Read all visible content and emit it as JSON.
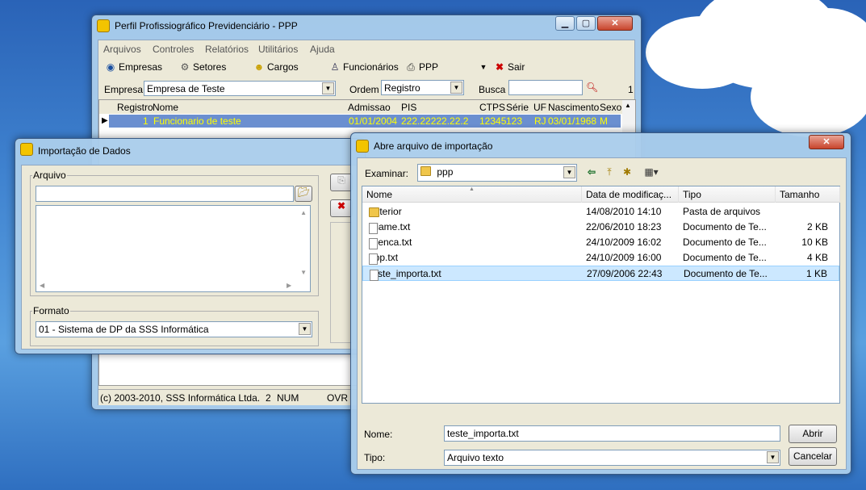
{
  "main_window": {
    "title": "Perfil Profissiográfico Previdenciário - PPP",
    "menu": [
      "Arquivos",
      "Controles",
      "Relatórios",
      "Utilitários",
      "Ajuda"
    ],
    "toolbar": {
      "empresas": "Empresas",
      "setores": "Setores",
      "cargos": "Cargos",
      "funcionarios": "Funcionários",
      "ppp": "PPP",
      "sair": "Sair"
    },
    "filter": {
      "empresa_label": "Empresa",
      "empresa_value": "Empresa de Teste",
      "ordem_label": "Ordem",
      "ordem_value": "Registro",
      "busca_label": "Busca",
      "busca_value": "",
      "count": "1"
    },
    "grid": {
      "headers": [
        "Registro",
        "Nome",
        "Admissao",
        "PIS",
        "CTPS",
        "Série",
        "UF",
        "Nascimento",
        "Sexo"
      ],
      "rows": [
        [
          "1",
          "Funcionario de teste",
          "01/01/2004",
          "222.22222.22.2",
          "12345",
          "123",
          "RJ",
          "03/01/1968",
          "M"
        ]
      ]
    },
    "status": {
      "copyright": "(c) 2003-2010, SSS Informática Ltda.",
      "panel2": "2",
      "num": "NUM",
      "ovr": "OVR"
    }
  },
  "import_window": {
    "title": "Importação de Dados",
    "arquivo_label": "Arquivo",
    "arquivo_value": "",
    "formato_label": "Formato",
    "formato_value": "01 - Sistema de DP da SSS Informática"
  },
  "file_dialog": {
    "title": "Abre arquivo de importação",
    "lookin_label": "Examinar:",
    "lookin_value": "ppp",
    "columns": [
      "Nome",
      "Data de modificaç...",
      "Tipo",
      "Tamanho"
    ],
    "files": [
      {
        "name": "anterior",
        "date": "14/08/2010 14:10",
        "type": "Pasta de arquivos",
        "size": "",
        "icon": "folder-icon"
      },
      {
        "name": "leiame.txt",
        "date": "22/06/2010 18:23",
        "type": "Documento de Te...",
        "size": "2 KB",
        "icon": "text-file-icon"
      },
      {
        "name": "licenca.txt",
        "date": "24/10/2009 16:02",
        "type": "Documento de Te...",
        "size": "10 KB",
        "icon": "text-file-icon"
      },
      {
        "name": "ppp.txt",
        "date": "24/10/2009 16:00",
        "type": "Documento de Te...",
        "size": "4 KB",
        "icon": "text-file-icon"
      },
      {
        "name": "teste_importa.txt",
        "date": "27/09/2006 22:43",
        "type": "Documento de Te...",
        "size": "1 KB",
        "icon": "text-file-icon"
      }
    ],
    "selected_index": 4,
    "filename_label": "Nome:",
    "filename_value": "teste_importa.txt",
    "filetype_label": "Tipo:",
    "filetype_value": "Arquivo texto",
    "open_button": "Abrir",
    "cancel_button": "Cancelar"
  },
  "colors": {
    "selection": "#3b6fb6",
    "highlight_text": "#ffff00",
    "grid_selection_bg": "#6b8fd0"
  }
}
